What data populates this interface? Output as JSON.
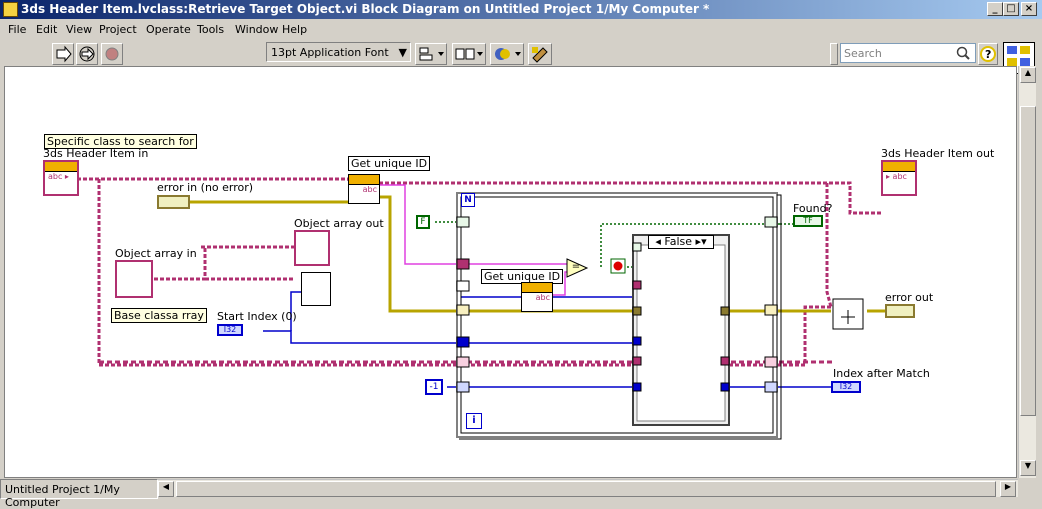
{
  "window": {
    "title": "3ds Header Item.lvclass:Retrieve Target Object.vi Block Diagram on Untitled Project 1/My Computer *",
    "minimize": "_",
    "maximize": "□",
    "close": "×"
  },
  "menu": [
    "File",
    "Edit",
    "View",
    "Project",
    "Operate",
    "Tools",
    "Window",
    "Help"
  ],
  "toolbar": {
    "font": "13pt Application Font",
    "search_placeholder": "Search"
  },
  "labels": {
    "tooltip": "Specific class to search for",
    "header_in": "3ds Header Item in",
    "header_out": "3ds Header Item out",
    "error_in": "error in (no error)",
    "error_out": "error out",
    "get_id_1": "Get unique ID",
    "get_id_2": "Get unique ID",
    "obj_array_out": "Object array out",
    "obj_array_in": "Object array in",
    "base_array": "Base classa rray",
    "start_index": "Start Index (0)",
    "found": "Found?",
    "index_after": "Index after Match",
    "case_value": "False",
    "const_f": "F",
    "const_neg1": "-1",
    "loop_i": "i",
    "loop_n": "N",
    "i32_a": "I32",
    "i32_b": "I32",
    "tf": "TF",
    "eq": "="
  },
  "status": "Untitled Project 1/My Computer",
  "colors": {
    "class_wire": "#b03070",
    "error_wire": "#b8a400",
    "int_wire": "#0000cc",
    "bool_wire": "#006600",
    "string_wire": "#e040e0"
  }
}
